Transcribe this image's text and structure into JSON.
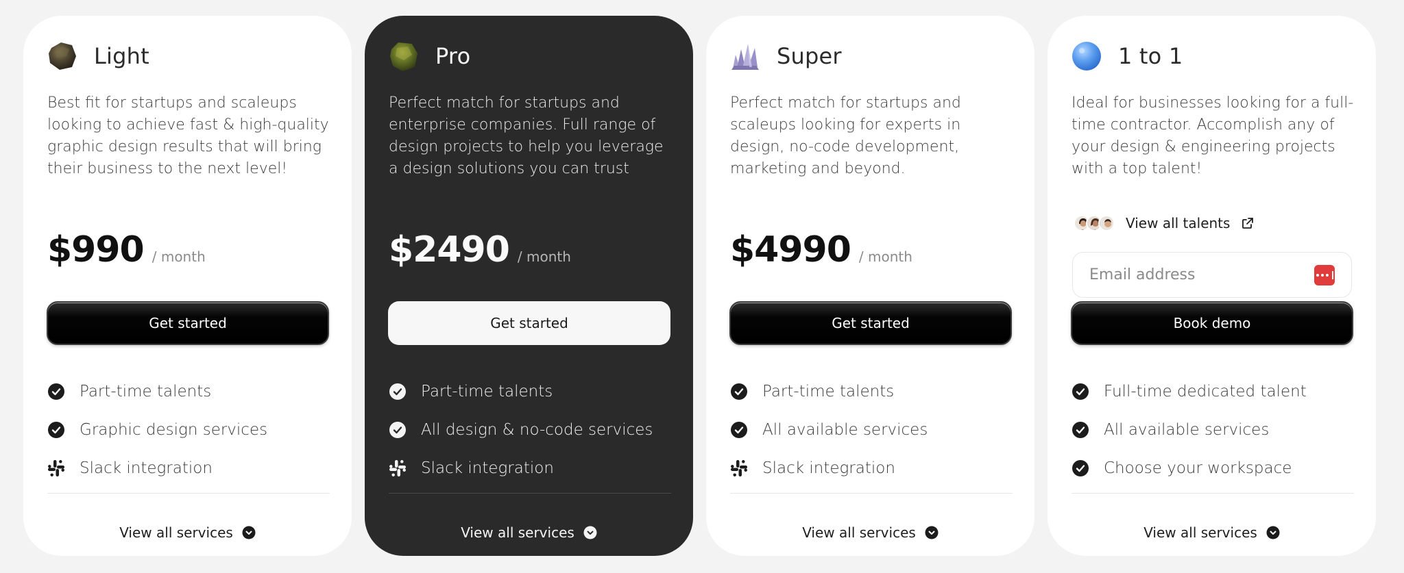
{
  "plans": [
    {
      "name": "Light",
      "icon": "rock-icon",
      "description": "Best fit for startups and scaleups looking to achieve fast & high-quality graphic design results that will bring their business to the next level!",
      "price": "$990",
      "period": "/ month",
      "cta": "Get started",
      "features": [
        "Part-time talents",
        "Graphic design services",
        "Slack integration"
      ],
      "more": "View all services"
    },
    {
      "name": "Pro",
      "icon": "mossy-rock-icon",
      "description": "Perfect match for startups and enterprise companies. Full range of design projects to help you leverage a design solutions you can trust",
      "price": "$2490",
      "period": "/ month",
      "cta": "Get started",
      "features": [
        "Part-time talents",
        "All design & no-code services",
        "Slack integration"
      ],
      "more": "View all services"
    },
    {
      "name": "Super",
      "icon": "crystal-icon",
      "description": "Perfect match for startups and scaleups looking for experts in design, no-code development, marketing and beyond.",
      "price": "$4990",
      "period": "/ month",
      "cta": "Get started",
      "features": [
        "Part-time talents",
        "All available services",
        "Slack integration"
      ],
      "more": "View all services"
    },
    {
      "name": "1 to 1",
      "icon": "blue-orb-icon",
      "description": "Ideal for businesses looking for a full-time contractor. Accomplish any of your design & engineering projects with a top talent!",
      "talents_link": "View all talents",
      "email_placeholder": "Email address",
      "cta": "Book demo",
      "features": [
        "Full-time dedicated talent",
        "All available services",
        "Choose your workspace"
      ],
      "more": "View all services"
    }
  ],
  "colors": {
    "page_bg": "#f3f3f3",
    "card_bg": "#ffffff",
    "card_dark_bg": "#2a2a2a",
    "password_manager": "#e03c3c"
  }
}
